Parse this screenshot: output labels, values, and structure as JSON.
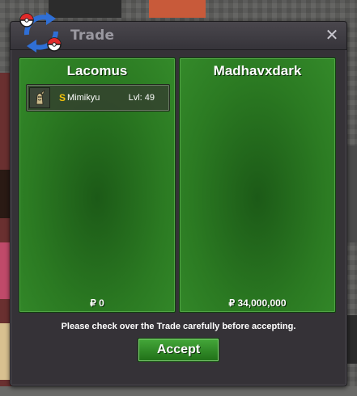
{
  "window": {
    "title": "Trade",
    "close_icon": "close-icon",
    "logo_icon": "trade-swap-icon"
  },
  "left_panel": {
    "player_name": "Lacomus",
    "money": "₽ 0",
    "items": [
      {
        "shiny_marker": "S",
        "name": "Mimikyu",
        "level": "Lvl: 49",
        "icon": "mimikyu-sprite-icon"
      }
    ]
  },
  "right_panel": {
    "player_name": "Madhavxdark",
    "money": "₽ 34,000,000",
    "items": []
  },
  "footer": {
    "notice": "Please check over the Trade carefully before accepting.",
    "accept_label": "Accept"
  },
  "colors": {
    "panel_green": "#2b7a22",
    "window_bg": "#353237",
    "shiny_gold": "#f3c20b",
    "accept_green": "#45a83a"
  }
}
